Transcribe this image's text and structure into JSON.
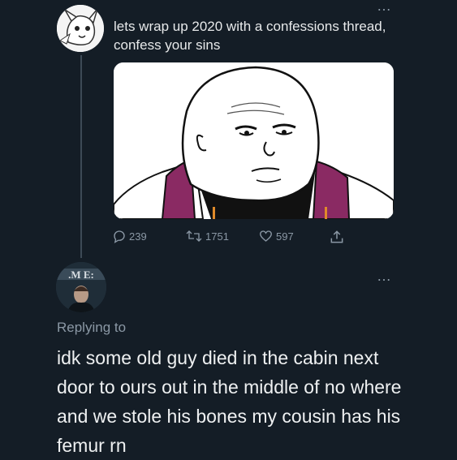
{
  "tweet": {
    "text": "lets wrap up 2020 with a confessions thread, confess your sins",
    "more_label": "…",
    "media_alt": "wojak meme face in purple vest",
    "stats": {
      "replies": "239",
      "retweets": "1751",
      "likes": "597"
    }
  },
  "reply": {
    "replying_to": "Replying to",
    "more_label": "…",
    "text": "idk some old guy died in the cabin next door to ours out in the middle of no where and we stole his bones my cousin has his femur rn"
  },
  "icons": {
    "reply": "comment-icon",
    "retweet": "retweet-icon",
    "like": "heart-icon",
    "share": "share-icon",
    "more": "more-icon"
  },
  "colors": {
    "background": "#141d26",
    "text": "#e7e9ea",
    "muted": "#8b98a5"
  }
}
